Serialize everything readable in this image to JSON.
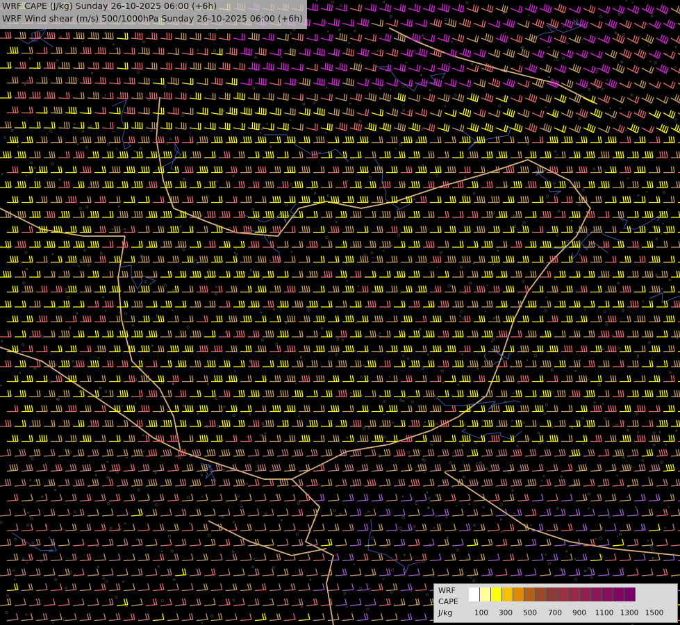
{
  "title": {
    "line1": "WRF CAPE (J/kg) Sunday 26-10-2025 06:00 (+6h)",
    "line2": "WRF Wind shear (m/s) 500/1000hPa Sunday 26-10-2025 06:00 (+6h)"
  },
  "legend": {
    "model": "WRF",
    "variable": "CAPE",
    "unit": "J/kg",
    "colors": [
      "#ffffff",
      "#ffff99",
      "#ffff00",
      "#f5c000",
      "#e08a00",
      "#b0601a",
      "#9a4a2a",
      "#8c3a33",
      "#9b3040",
      "#962848",
      "#8f2050",
      "#8a1858",
      "#85105e",
      "#800864",
      "#7a0068"
    ],
    "ticks": [
      "100",
      "300",
      "500",
      "700",
      "900",
      "1100",
      "1300",
      "1500"
    ]
  },
  "map": {
    "barb_colors": [
      "#ffff00",
      "#c8a060",
      "#e86b6b",
      "#e020e0",
      "#a060d0",
      "#c07e7e"
    ]
  }
}
